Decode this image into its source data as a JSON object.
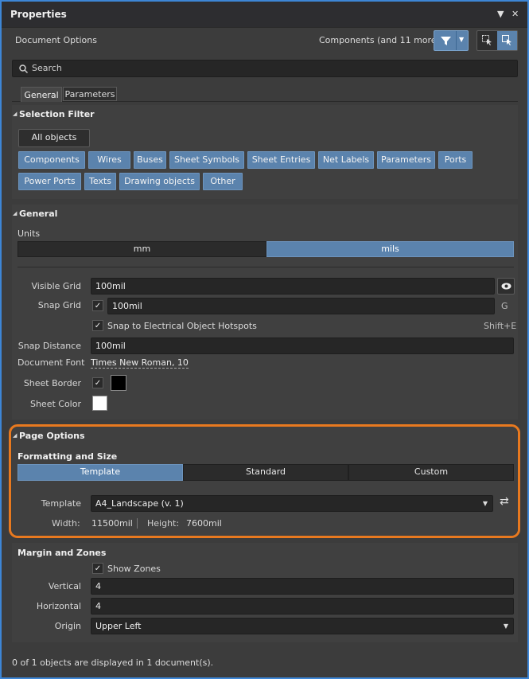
{
  "panel": {
    "title": "Properties"
  },
  "header": {
    "doc_options": "Document Options",
    "filter_summary": "Components (and 11 more)"
  },
  "search": {
    "placeholder": "Search"
  },
  "tabs": [
    {
      "label": "General"
    },
    {
      "label": "Parameters"
    }
  ],
  "selection_filter": {
    "title": "Selection Filter",
    "all_objects": "All objects",
    "row1": [
      "Components",
      "Wires",
      "Buses",
      "Sheet Symbols",
      "Sheet Entries",
      "Net Labels",
      "Parameters",
      "Ports"
    ],
    "row2": [
      "Power Ports",
      "Texts",
      "Drawing objects",
      "Other"
    ]
  },
  "general": {
    "title": "General",
    "units_label": "Units",
    "units": [
      "mm",
      "mils"
    ],
    "units_selected": "mils",
    "visible_grid_label": "Visible Grid",
    "visible_grid": "100mil",
    "snap_grid_label": "Snap Grid",
    "snap_grid": "100mil",
    "snap_grid_shortcut": "G",
    "snap_hotspots_label": "Snap to Electrical Object Hotspots",
    "snap_hotspots_shortcut": "Shift+E",
    "snap_distance_label": "Snap Distance",
    "snap_distance": "100mil",
    "document_font_label": "Document Font",
    "document_font": "Times New Roman, 10",
    "sheet_border_label": "Sheet Border",
    "sheet_color_label": "Sheet Color"
  },
  "page_options": {
    "title": "Page Options",
    "formatting_title": "Formatting and Size",
    "modes": [
      "Template",
      "Standard",
      "Custom"
    ],
    "mode_selected": "Template",
    "template_label": "Template",
    "template_value": "A4_Landscape (v. 1)",
    "width_label": "Width:",
    "width_value": "11500mil",
    "height_label": "Height:",
    "height_value": "7600mil",
    "highlight_color": "#e8791f"
  },
  "margin_zones": {
    "title": "Margin and Zones",
    "show_zones_label": "Show Zones",
    "vertical_label": "Vertical",
    "vertical": "4",
    "horizontal_label": "Horizontal",
    "horizontal": "4",
    "origin_label": "Origin",
    "origin": "Upper Left"
  },
  "status": {
    "text": "0 of 1 objects are displayed in 1 document(s)."
  },
  "colors": {
    "accent": "#5b83ad",
    "background": "#3c3c3c",
    "frame": "#3d86d6"
  }
}
